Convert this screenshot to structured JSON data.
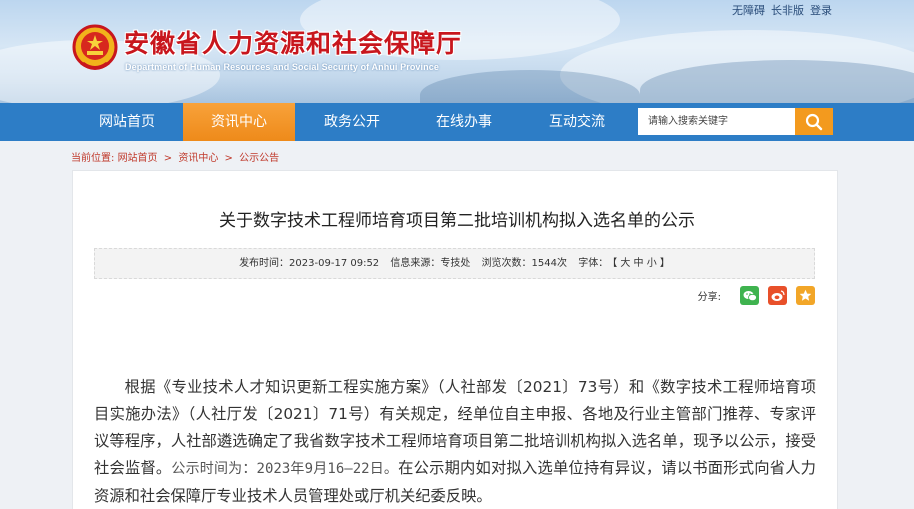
{
  "header": {
    "top_links": [
      "无障碍",
      "长非版",
      "登录"
    ],
    "site_title": "安徽省人力资源和社会保障厅",
    "site_subtitle": "Department of Human Resources and Social Security of Anhui Province"
  },
  "nav": {
    "items": [
      "网站首页",
      "资讯中心",
      "政务公开",
      "在线办事",
      "互动交流"
    ],
    "active_index": 1,
    "search_placeholder": "请输入搜索关键字",
    "active_color": "#f39a1e",
    "bar_color": "#2d7dc6"
  },
  "breadcrumb": {
    "prefix": "当前位置:",
    "items": [
      "网站首页",
      "资讯中心",
      "公示公告"
    ],
    "separator": ">"
  },
  "article": {
    "title": "关于数字技术工程师培育项目第二批培训机构拟入选名单的公示",
    "meta": {
      "publish_time": "发布时间：2023-09-17 09:52",
      "source": "信息来源：专技处",
      "views": "浏览次数：1544次",
      "font_label": "字体：",
      "font_sizes": "【 大 中 小 】"
    },
    "share_label": "分享:",
    "share_icons": [
      "wechat-icon",
      "weibo-icon",
      "favorite-icon"
    ],
    "body_part1": "根据《专业技术人才知识更新工程实施方案》（人社部发〔2021〕73号）和《数字技术工程师培育项目实施办法》（人社厅发〔2021〕71号）有关规定，经单位自主申报、各地及行业主管部门推荐、专家评议等程序，人社部遴选确定了我省数字技术工程师培育项目第二批培训机构拟入选名单，现予以公示，接受社会监督。",
    "body_period": "公示时间为：2023年9月16—22日。",
    "body_part2": "在公示期内如对拟入选单位持有异议，请以书面形式向省人力资源和社会保障厅专业技术人员管理处或厅机关纪委反映。"
  }
}
